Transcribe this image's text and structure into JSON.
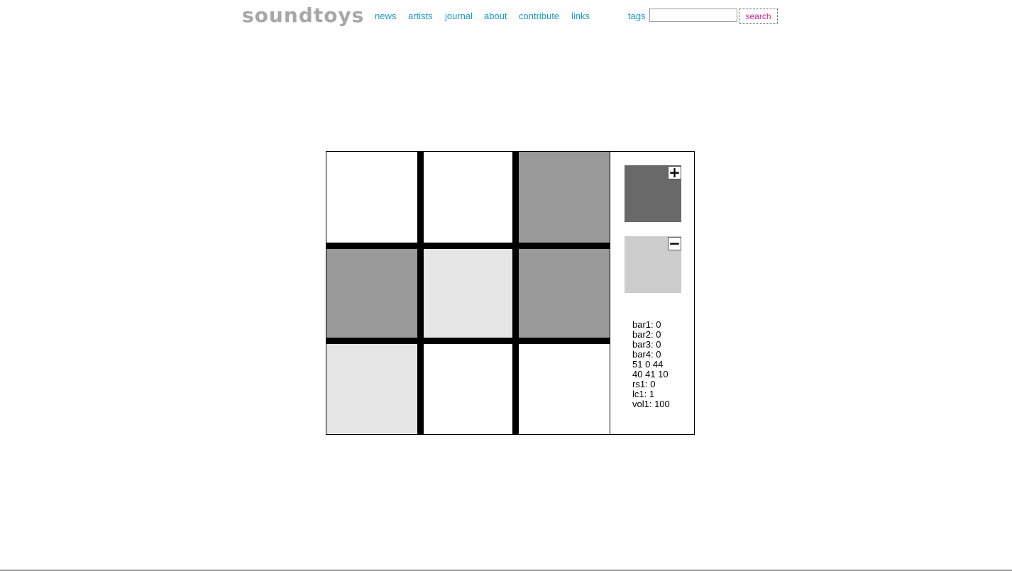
{
  "header": {
    "logo": "soundtoys",
    "nav": [
      "news",
      "artists",
      "journal",
      "about",
      "contribute",
      "links"
    ],
    "tags_label": "tags",
    "search": {
      "value": "",
      "placeholder": ""
    },
    "search_button": "search"
  },
  "grid": {
    "colors": {
      "white": "#ffffff",
      "light": "#e6e6e6",
      "mid": "#999999"
    },
    "rows": [
      [
        "white",
        "white",
        "mid"
      ],
      [
        "mid",
        "light",
        "mid"
      ],
      [
        "light",
        "white",
        "white"
      ]
    ]
  },
  "panel": {
    "plus_icon": "plus-icon",
    "minus_icon": "minus-icon",
    "plus_color": "#696969",
    "minus_color": "#cccccc",
    "stats": [
      "bar1: 0",
      "bar2: 0",
      "bar3: 0",
      "bar4: 0",
      "51 0 44",
      "40 41 10",
      "rs1: 0",
      "lc1: 1",
      "vol1: 100"
    ]
  }
}
